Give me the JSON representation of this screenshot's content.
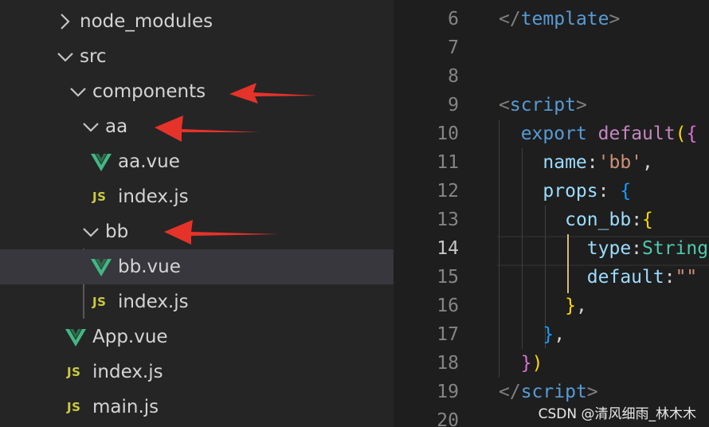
{
  "explorer": {
    "items": [
      {
        "label": "node_modules",
        "kind": "folder",
        "state": "collapsed"
      },
      {
        "label": "src",
        "kind": "folder",
        "state": "expanded"
      },
      {
        "label": "components",
        "kind": "folder",
        "state": "expanded"
      },
      {
        "label": "aa",
        "kind": "folder",
        "state": "expanded"
      },
      {
        "label": "aa.vue",
        "kind": "vue"
      },
      {
        "label": "index.js",
        "kind": "js"
      },
      {
        "label": "bb",
        "kind": "folder",
        "state": "expanded"
      },
      {
        "label": "bb.vue",
        "kind": "vue",
        "selected": true
      },
      {
        "label": "index.js",
        "kind": "js"
      },
      {
        "label": "App.vue",
        "kind": "vue"
      },
      {
        "label": "index.js",
        "kind": "js"
      },
      {
        "label": "main.js",
        "kind": "js"
      }
    ],
    "js_badge": "JS",
    "vue_icon_color": "#41b883",
    "js_icon_color": "#cbcb41",
    "annotation_arrow_color": "#e5332a"
  },
  "editor": {
    "active_line": "14",
    "lines": [
      {
        "num": "6",
        "tokens": [
          [
            "t-tag",
            "</"
          ],
          [
            "t-name",
            "template"
          ],
          [
            "t-tag",
            ">"
          ]
        ]
      },
      {
        "num": "7",
        "tokens": []
      },
      {
        "num": "8",
        "tokens": []
      },
      {
        "num": "9",
        "tokens": [
          [
            "t-tag",
            "<"
          ],
          [
            "t-name",
            "script"
          ],
          [
            "t-tag",
            ">"
          ]
        ]
      },
      {
        "num": "10",
        "tokens": [
          [
            "t-punc",
            "  "
          ],
          [
            "t-kw",
            "export"
          ],
          [
            "t-punc",
            " "
          ],
          [
            "t-kw2",
            "default"
          ],
          [
            "t-b1",
            "("
          ],
          [
            "t-b2",
            "{"
          ]
        ]
      },
      {
        "num": "11",
        "tokens": [
          [
            "t-punc",
            "    "
          ],
          [
            "t-prop",
            "name"
          ],
          [
            "t-punc",
            ":"
          ],
          [
            "t-str",
            "'bb'"
          ],
          [
            "t-punc",
            ","
          ]
        ]
      },
      {
        "num": "12",
        "tokens": [
          [
            "t-punc",
            "    "
          ],
          [
            "t-prop",
            "props"
          ],
          [
            "t-punc",
            ": "
          ],
          [
            "t-b3",
            "{"
          ]
        ]
      },
      {
        "num": "13",
        "tokens": [
          [
            "t-punc",
            "      "
          ],
          [
            "t-prop",
            "con_bb"
          ],
          [
            "t-punc",
            ":"
          ],
          [
            "t-b1",
            "{"
          ]
        ]
      },
      {
        "num": "14",
        "tokens": [
          [
            "t-punc",
            "        "
          ],
          [
            "t-prop",
            "type"
          ],
          [
            "t-punc",
            ":"
          ],
          [
            "t-type",
            "String"
          ]
        ]
      },
      {
        "num": "15",
        "tokens": [
          [
            "t-punc",
            "        "
          ],
          [
            "t-prop",
            "default"
          ],
          [
            "t-punc",
            ":"
          ],
          [
            "t-str",
            "\"\""
          ]
        ]
      },
      {
        "num": "16",
        "tokens": [
          [
            "t-punc",
            "      "
          ],
          [
            "t-b1",
            "}"
          ],
          [
            "t-punc",
            ","
          ]
        ]
      },
      {
        "num": "17",
        "tokens": [
          [
            "t-punc",
            "    "
          ],
          [
            "t-b3",
            "}"
          ],
          [
            "t-punc",
            ","
          ]
        ]
      },
      {
        "num": "18",
        "tokens": [
          [
            "t-punc",
            "  "
          ],
          [
            "t-b2",
            "}"
          ],
          [
            "t-b1",
            ")"
          ]
        ]
      },
      {
        "num": "19",
        "tokens": [
          [
            "t-tag",
            "</"
          ],
          [
            "t-name",
            "script"
          ],
          [
            "t-tag",
            ">"
          ]
        ]
      },
      {
        "num": "20",
        "tokens": []
      }
    ]
  },
  "watermark": "CSDN @清风细雨_林木木"
}
